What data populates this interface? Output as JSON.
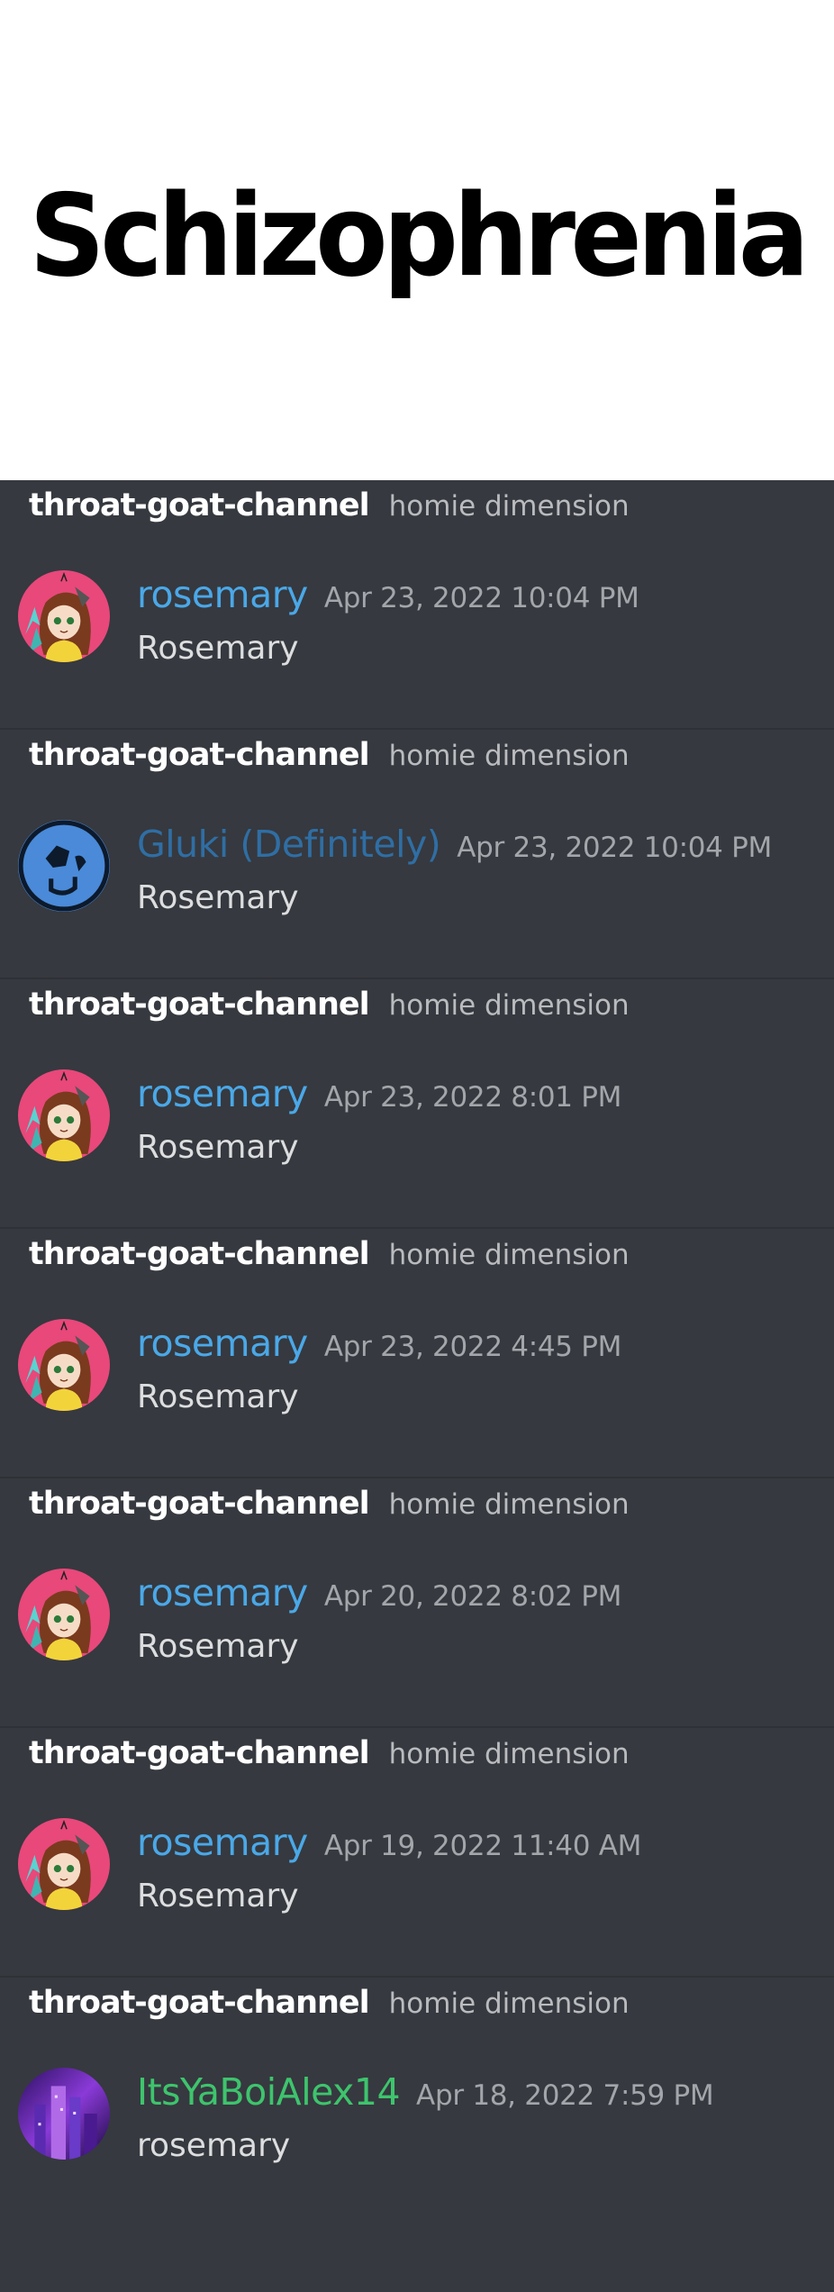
{
  "title": "Schizophrenia",
  "colors": {
    "background": "#36393f",
    "divider": "#2f3136",
    "channel": "#ffffff",
    "server": "#b9bbbe",
    "timestamp": "#a3a6aa",
    "message": "#dcddde"
  },
  "results": [
    {
      "channel": "throat-goat-channel",
      "server": "homie dimension",
      "avatar": "rosemary-avatar",
      "username": "rosemary",
      "username_color": "#4aa8e8",
      "timestamp": "Apr 23, 2022 10:04 PM",
      "message": "Rosemary"
    },
    {
      "channel": "throat-goat-channel",
      "server": "homie dimension",
      "avatar": "gluki-avatar",
      "username": "Gluki (Definitely)",
      "username_color": "#2f6ea4",
      "timestamp": "Apr 23, 2022 10:04 PM",
      "message": "Rosemary"
    },
    {
      "channel": "throat-goat-channel",
      "server": "homie dimension",
      "avatar": "rosemary-avatar",
      "username": "rosemary",
      "username_color": "#4aa8e8",
      "timestamp": "Apr 23, 2022 8:01 PM",
      "message": "Rosemary"
    },
    {
      "channel": "throat-goat-channel",
      "server": "homie dimension",
      "avatar": "rosemary-avatar",
      "username": "rosemary",
      "username_color": "#4aa8e8",
      "timestamp": "Apr 23, 2022 4:45 PM",
      "message": "Rosemary"
    },
    {
      "channel": "throat-goat-channel",
      "server": "homie dimension",
      "avatar": "rosemary-avatar",
      "username": "rosemary",
      "username_color": "#4aa8e8",
      "timestamp": "Apr 20, 2022 8:02 PM",
      "message": "Rosemary"
    },
    {
      "channel": "throat-goat-channel",
      "server": "homie dimension",
      "avatar": "rosemary-avatar",
      "username": "rosemary",
      "username_color": "#4aa8e8",
      "timestamp": "Apr 19, 2022 11:40 AM",
      "message": "Rosemary"
    },
    {
      "channel": "throat-goat-channel",
      "server": "homie dimension",
      "avatar": "alex-avatar",
      "username": "ItsYaBoiAlex14",
      "username_color": "#3ec46d",
      "timestamp": "Apr 18, 2022 7:59 PM",
      "message": "rosemary"
    }
  ]
}
